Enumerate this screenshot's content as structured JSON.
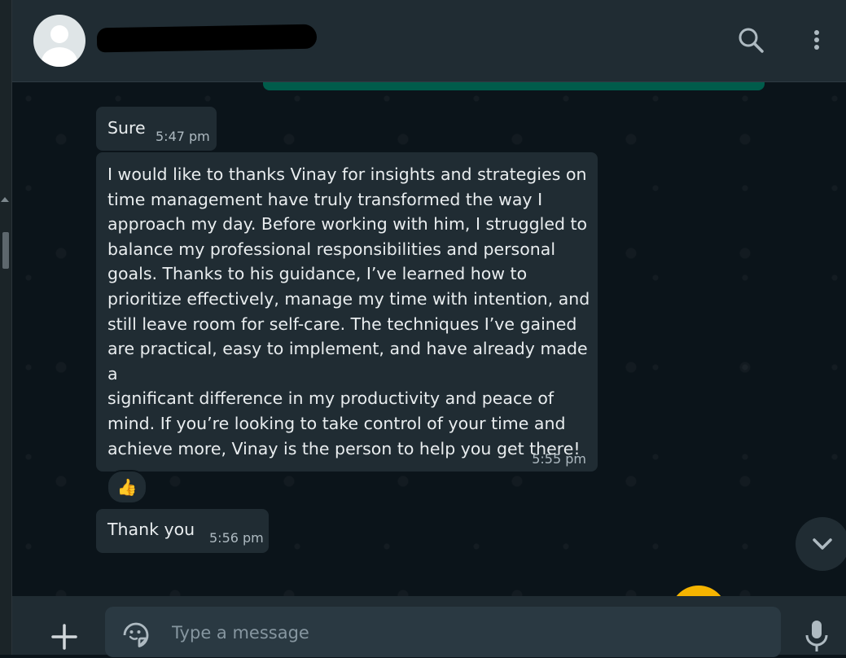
{
  "header": {
    "contact_name": "",
    "icons": [
      "default-avatar-icon",
      "search-icon",
      "more-options-icon"
    ]
  },
  "messages": [
    {
      "text": "Sure",
      "time": "5:47 pm"
    },
    {
      "text": "I would like to thanks Vinay for insights and strategies on\ntime management have truly transformed the way I\napproach my day. Before working with him, I struggled to\nbalance my professional responsibilities and personal\ngoals. Thanks to his guidance, I’ve learned how to\nprioritize effectively, manage my time with intention, and\nstill leave room for self-care. The techniques I’ve gained\nare practical, easy to implement, and have already made a\nsignificant difference in my productivity and peace of\nmind. If you’re looking to take control of your time and\nachieve more, Vinay is the person to help you get there!",
      "time": "5:55 pm",
      "reaction": "👍"
    },
    {
      "text": "Thank  you",
      "time": "5:56 pm"
    }
  ],
  "composer": {
    "placeholder": "Type a message",
    "value": "",
    "icons": [
      "plus-icon",
      "sticker-icon",
      "microphone-icon"
    ]
  },
  "colors": {
    "background": "#0b141a",
    "panel": "#202c33",
    "bubble_incoming": "#202c33",
    "bubble_outgoing": "#005c4b",
    "text_primary": "#e9edef",
    "text_secondary": "#aebac1"
  }
}
